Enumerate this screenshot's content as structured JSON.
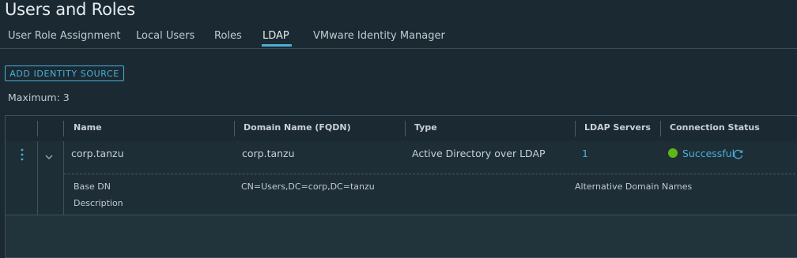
{
  "page": {
    "title": "Users and Roles"
  },
  "tabs": [
    {
      "label": "User Role Assignment"
    },
    {
      "label": "Local Users"
    },
    {
      "label": "Roles"
    },
    {
      "label": "LDAP",
      "active": true
    },
    {
      "label": "VMware Identity Manager"
    }
  ],
  "actions": {
    "add_identity_source": "ADD IDENTITY SOURCE"
  },
  "maximum_text": "Maximum: 3",
  "grid": {
    "columns": [
      "Name",
      "Domain Name (FQDN)",
      "Type",
      "LDAP Servers",
      "Connection Status"
    ],
    "rows": [
      {
        "name": "corp.tanzu",
        "domain": "corp.tanzu",
        "type": "Active Directory over LDAP",
        "ldap_servers": "1",
        "status": "Successful",
        "details": {
          "base_dn_label": "Base DN",
          "base_dn_value": "CN=Users,DC=corp,DC=tanzu",
          "alt_domain_label": "Alternative Domain Names",
          "description_label": "Description"
        }
      }
    ]
  },
  "colors": {
    "background": "#1b2a32",
    "accent": "#49afd9",
    "success": "#5eb715"
  },
  "icons": {
    "row_menu": "vertical-ellipsis-icon",
    "expand": "chevron-down-icon",
    "refresh": "refresh-icon",
    "status": "status-dot-icon"
  }
}
